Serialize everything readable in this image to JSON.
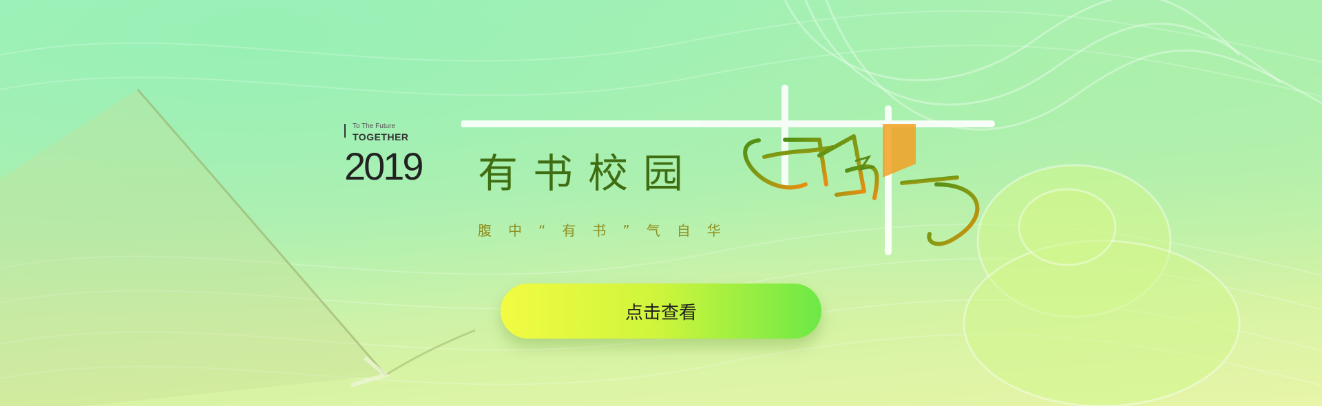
{
  "banner": {
    "tagline_en": "To The Future",
    "together": "TOGETHER",
    "year": "2019",
    "title": "有书校园",
    "art_title": "招聘",
    "subtitle": "腹中“有书”气自华",
    "cta_label": "点击查看"
  },
  "colors": {
    "title_green": "#3f6e12",
    "subtitle_olive": "#8f8f20",
    "cta_start": "#f2fb42",
    "cta_end": "#6de846",
    "art_orange": "#e88a14"
  }
}
